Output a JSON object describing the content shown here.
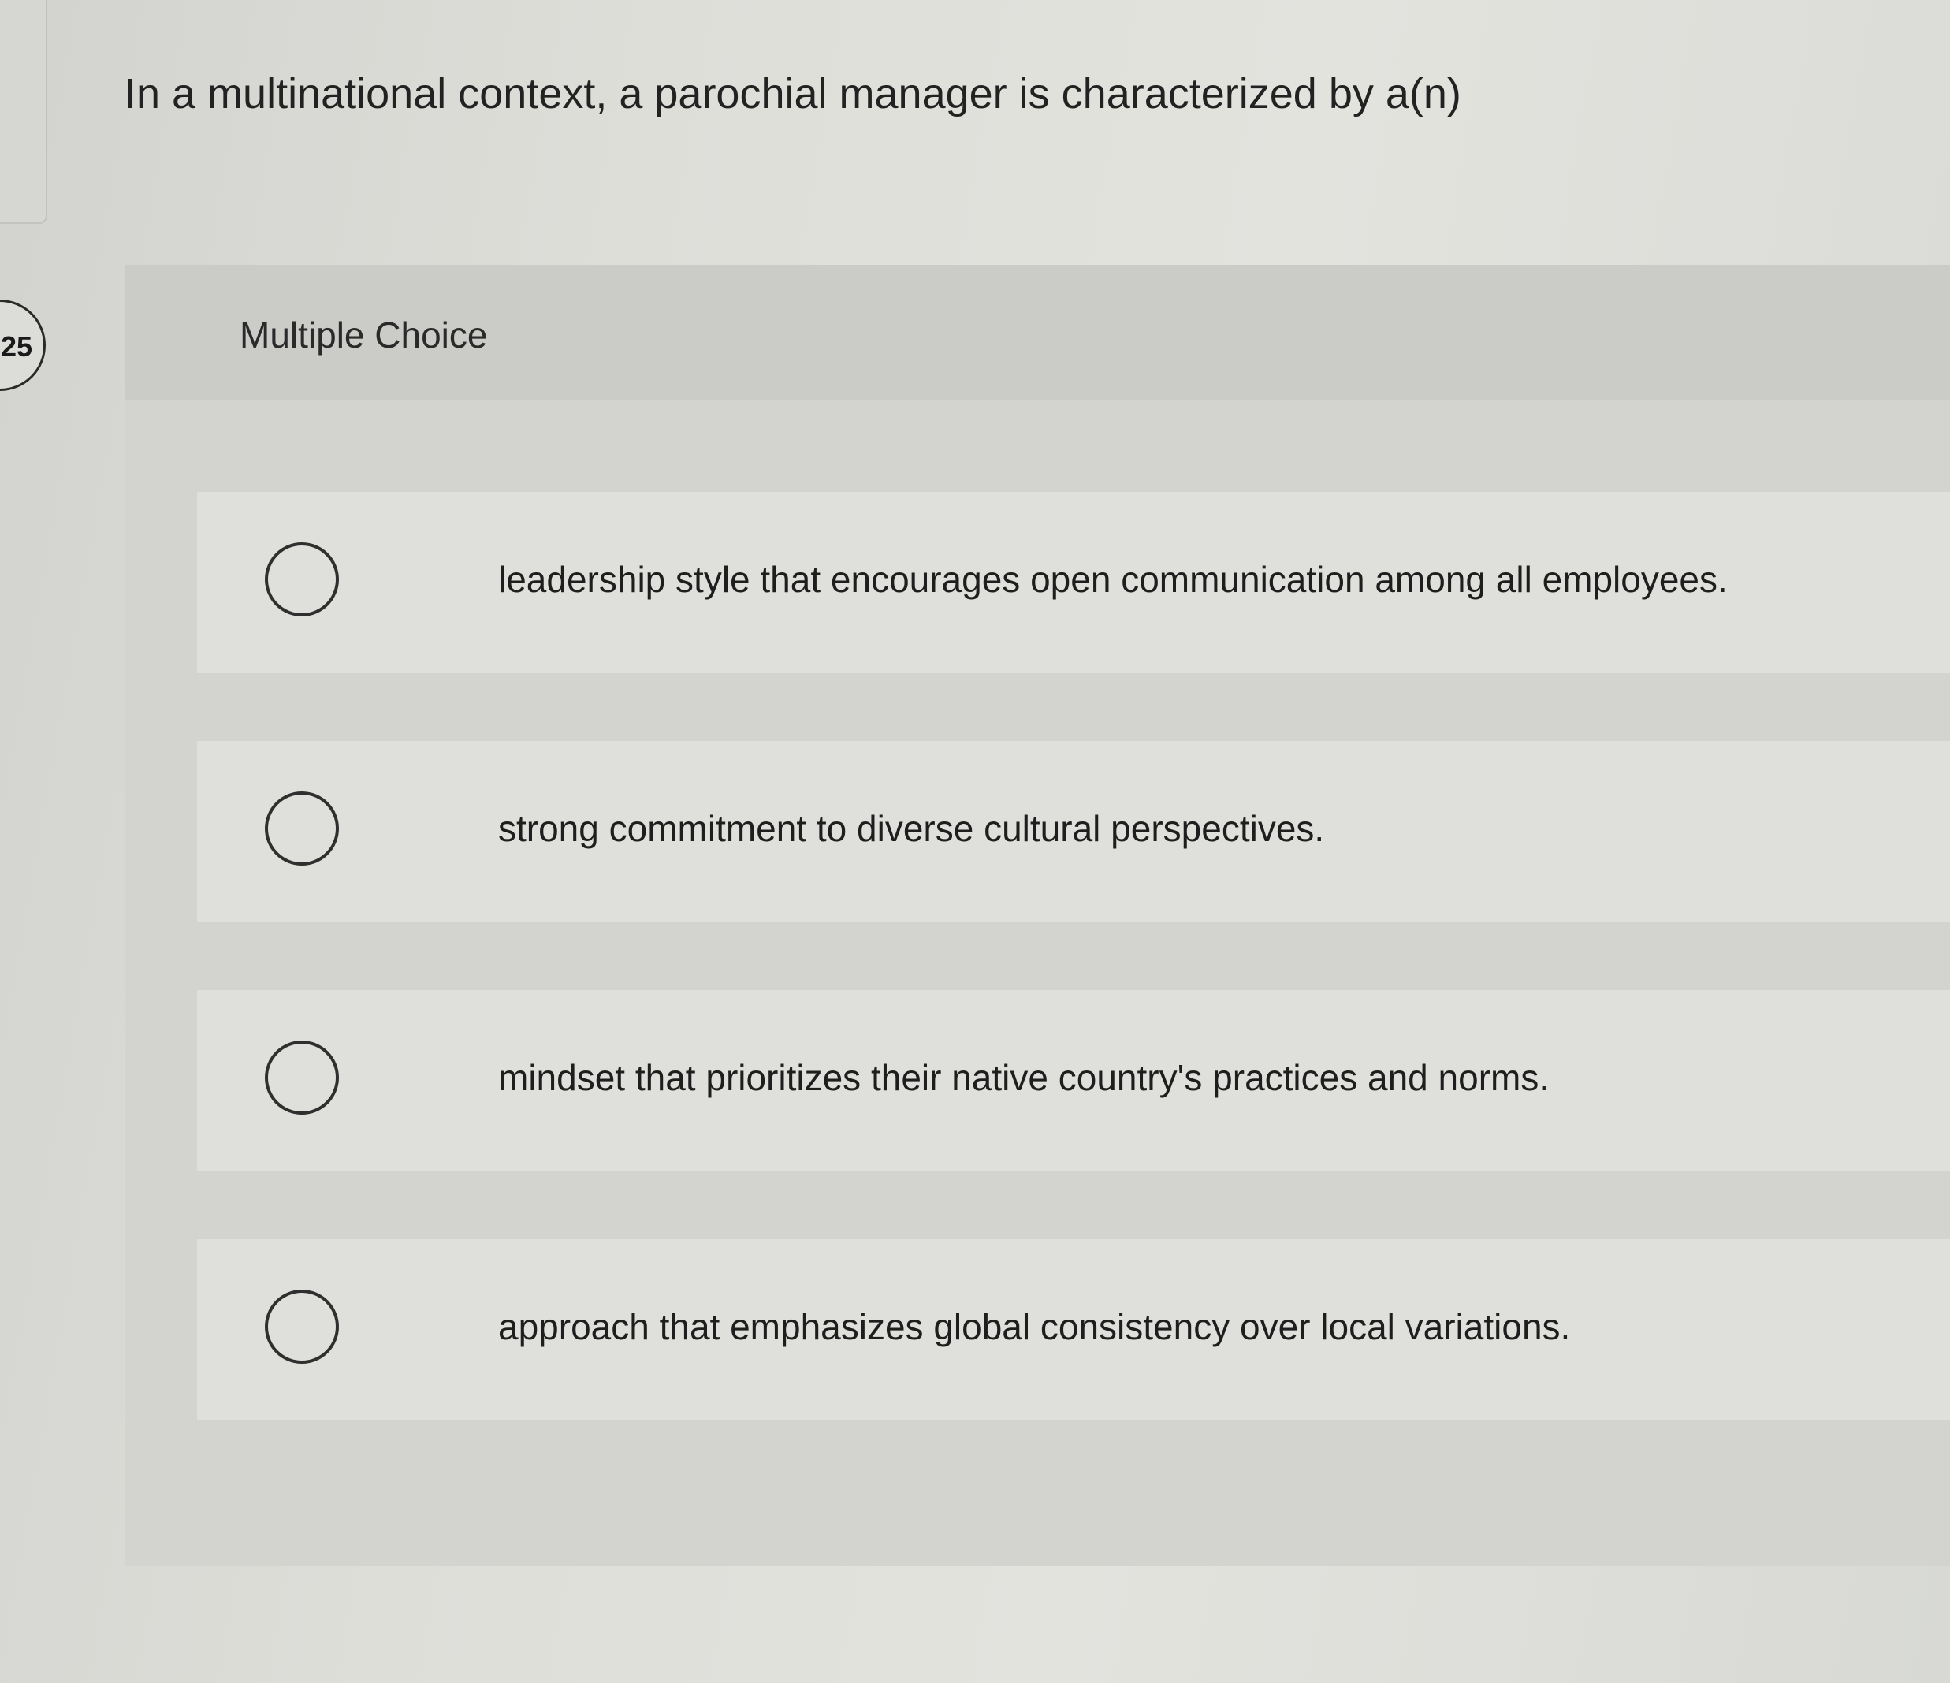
{
  "question": {
    "number": "25",
    "text": "In a multinational context, a parochial manager is characterized by a(n)"
  },
  "panel": {
    "header_label": "Multiple Choice"
  },
  "options": [
    {
      "label": "leadership style that encourages open communication among all employees.",
      "selected": false
    },
    {
      "label": "strong commitment to diverse cultural perspectives.",
      "selected": false
    },
    {
      "label": "mindset that prioritizes their native country's practices and norms.",
      "selected": false
    },
    {
      "label": "approach that emphasizes global consistency over local variations.",
      "selected": false
    }
  ]
}
